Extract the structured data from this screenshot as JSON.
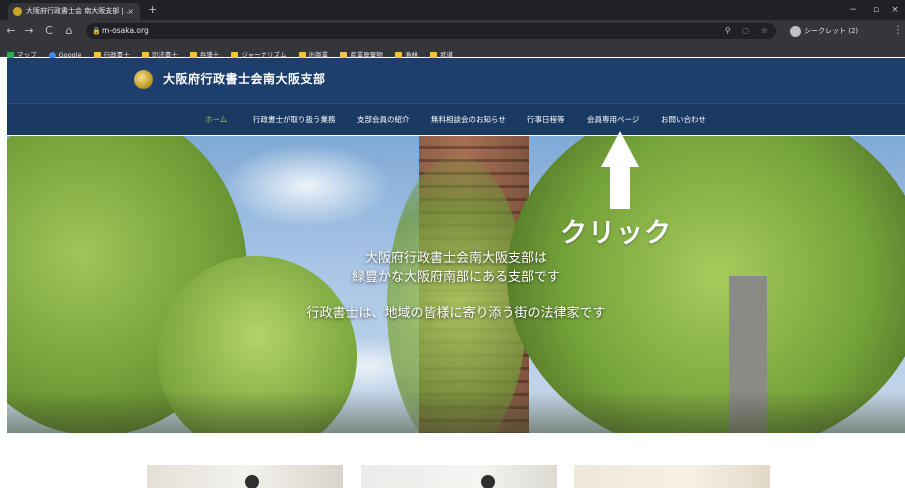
{
  "browser": {
    "tab_title": "大阪府行政書士会 南大阪支部 | ...",
    "tab_close": "×",
    "new_tab": "+",
    "window_controls": {
      "minimize": "−",
      "restore": "▫",
      "close": "×"
    },
    "url": "m-osaka.org",
    "incognito_label": "シークレット (2)",
    "nav": {
      "back": "←",
      "forward": "→",
      "reload": "C",
      "home": "⌂"
    },
    "bookmarks": [
      {
        "label": "マップ",
        "icon": "map-icon"
      },
      {
        "label": "Google",
        "icon": "google-icon"
      },
      {
        "label": "行政書士",
        "icon": "folder-icon"
      },
      {
        "label": "司法書士",
        "icon": "folder-icon"
      },
      {
        "label": "弁護士",
        "icon": "folder-icon"
      },
      {
        "label": "ジャーナリズム",
        "icon": "folder-icon"
      },
      {
        "label": "出版業",
        "icon": "folder-icon"
      },
      {
        "label": "産業廃棄物",
        "icon": "folder-icon"
      },
      {
        "label": "漁林",
        "icon": "folder-icon"
      },
      {
        "label": "武道",
        "icon": "folder-icon"
      }
    ]
  },
  "site": {
    "title": "大阪府行政書士会南大阪支部",
    "nav": [
      {
        "label": "ホーム",
        "active": true
      },
      {
        "label": "行政書士が取り扱う業務"
      },
      {
        "label": "支部会員の紹介"
      },
      {
        "label": "無料相談会のお知らせ"
      },
      {
        "label": "行事日程等"
      },
      {
        "label": "会員専用ページ"
      },
      {
        "label": "お問い合わせ"
      }
    ],
    "hero": {
      "line1": "大阪府行政書士会南大阪支部は",
      "line2": "緑豊かな大阪府南部にある支部です",
      "line3": "行政書士は、地域の皆様に寄り添う街の法律家です"
    }
  },
  "annotation": {
    "label": "クリック",
    "arrow_color": "#ffffff"
  },
  "colors": {
    "header_bg": "#1d3f6e",
    "nav_active": "#8fd14f",
    "browser_bg": "#202124"
  }
}
